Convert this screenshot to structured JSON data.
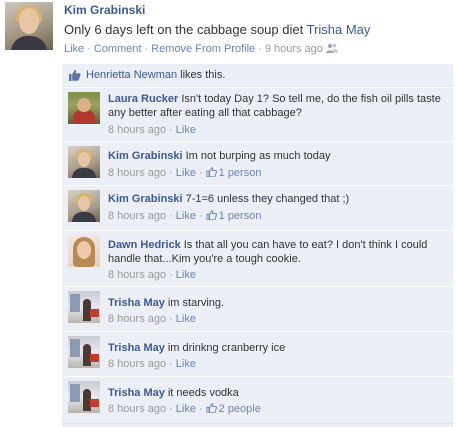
{
  "post": {
    "author": "Kim Grabinski",
    "text": "Only 6 days left on the cabbage soup diet",
    "tagged": "Trisha May",
    "actions": {
      "like": "Like",
      "comment": "Comment",
      "remove": "Remove From Profile",
      "time": "9 hours ago",
      "separator": "·"
    }
  },
  "likes": {
    "name": "Henrietta Newman",
    "suffix": " likes this."
  },
  "comments": [
    {
      "author": "Laura Rucker",
      "text": "Isn't today Day 1? So tell me, do the fish oil pills taste any better after eating all that cabbage?",
      "time": "8 hours ago",
      "like": "Like",
      "likes": ""
    },
    {
      "author": "Kim Grabinski",
      "text": "Im not burping as much today",
      "time": "8 hours ago",
      "like": "Like",
      "likes": "1 person"
    },
    {
      "author": "Kim Grabinski",
      "text": "7-1=6 unless they changed that ;)",
      "time": "8 hours ago",
      "like": "Like",
      "likes": "1 person"
    },
    {
      "author": "Dawn Hedrick",
      "text": "Is that all you can have to eat? I don't think I could handle that...Kim you're a tough cookie.",
      "time": "8 hours ago",
      "like": "Like",
      "likes": ""
    },
    {
      "author": "Trisha May",
      "text": "im starving.",
      "time": "8 hours ago",
      "like": "Like",
      "likes": ""
    },
    {
      "author": "Trisha May",
      "text": "im drinkng cranberry ice",
      "time": "8 hours ago",
      "like": "Like",
      "likes": ""
    },
    {
      "author": "Trisha May",
      "text": "it needs vodka",
      "time": "8 hours ago",
      "like": "Like",
      "likes": "2 people"
    }
  ],
  "colors": {
    "link": "#3b5998",
    "meta_link": "#6d84b4",
    "feedback_bg": "#eceff5",
    "meta_text": "#999999"
  },
  "icons": {
    "privacy": "friends-icon",
    "like": "thumbs-up-icon"
  }
}
